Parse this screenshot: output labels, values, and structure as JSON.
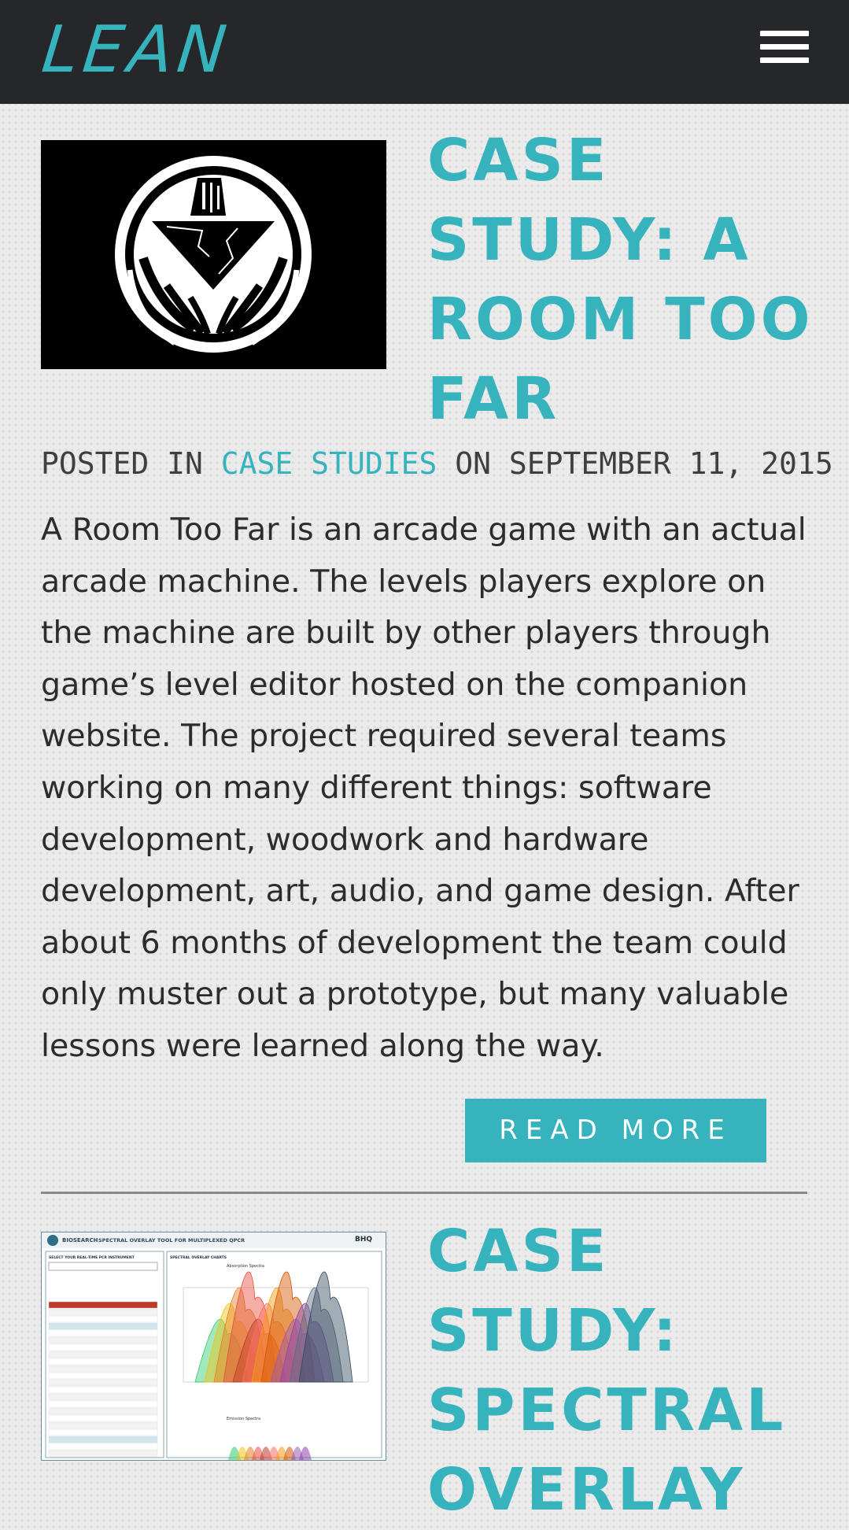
{
  "header": {
    "logo_text": "LEAN",
    "menu_icon": "hamburger-menu-icon",
    "background_color": "#25272b",
    "accent_color": "#36b3bd"
  },
  "posts": [
    {
      "title": "CASE STUDY: A ROOM TOO FAR",
      "thumbnail_icon": "ship-emblem-logo",
      "meta": {
        "posted_in_label": "POSTED IN",
        "category": "CASE STUDIES",
        "on_label": "ON",
        "date": "SEPTEMBER 11, 2015"
      },
      "excerpt": "A Room Too Far is an arcade game with an actual arcade machine. The levels players explore on the machine are built by other players through game’s level editor hosted on the companion website. The project required several teams working on many different things: software development, woodwork and hardware development, art, audio, and game design. After about 6 months of development the team could only muster out a prototype, but many valuable lessons were learned along the way.",
      "read_more_label": "READ MORE"
    },
    {
      "title": "CASE STUDY: SPECTRAL OVERLAY",
      "thumbnail_icon": "spectral-overlay-tool-screenshot",
      "thumbnail_text": {
        "brand": "BIOSEARCH",
        "tool_title": "SPECTRAL OVERLAY TOOL FOR MULTIPLEXED QPCR",
        "corner_logo": "BHQ",
        "left_panel_title": "SELECT YOUR REAL-TIME PCR INSTRUMENT",
        "right_panel_title": "SPECTRAL OVERLAY CHARTS",
        "chart1_title": "Absorption Spectra",
        "chart2_title": "Emission Spectra"
      }
    }
  ]
}
